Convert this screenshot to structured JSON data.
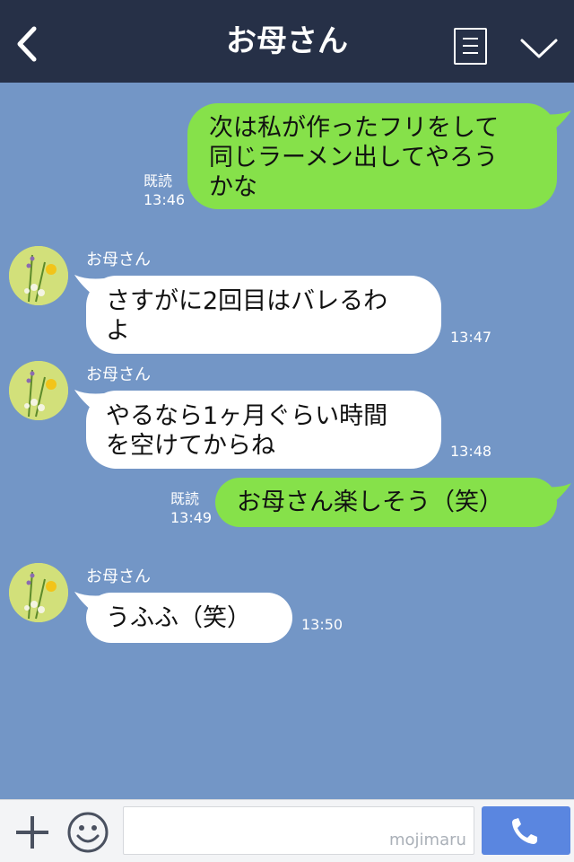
{
  "header": {
    "title": "お母さん",
    "bg": "#263047"
  },
  "messages": [
    {
      "from": "me",
      "lines": [
        "次は私が作ったフリをして",
        "同じラーメン出してやろう",
        "かな"
      ],
      "read": "既読",
      "time": "13:46"
    },
    {
      "from": "them",
      "sender": "お母さん",
      "lines": [
        "さすがに2回目はバレるわ",
        "よ"
      ],
      "time": "13:47"
    },
    {
      "from": "them",
      "sender": "お母さん",
      "lines": [
        "やるなら1ヶ月ぐらい時間",
        "を空けてからね"
      ],
      "time": "13:48"
    },
    {
      "from": "me",
      "lines": [
        "お母さん楽しそう（笑）"
      ],
      "read": "既読",
      "time": "13:49"
    },
    {
      "from": "them",
      "sender": "お母さん",
      "lines": [
        "うふふ（笑）"
      ],
      "time": "13:50"
    }
  ],
  "footer": {
    "input_value": "",
    "watermark": "mojimaru"
  },
  "colors": {
    "chat_bg": "#7396c6",
    "my_bubble": "#86e14a",
    "their_bubble": "#ffffff",
    "call_button": "#5a86e0"
  }
}
